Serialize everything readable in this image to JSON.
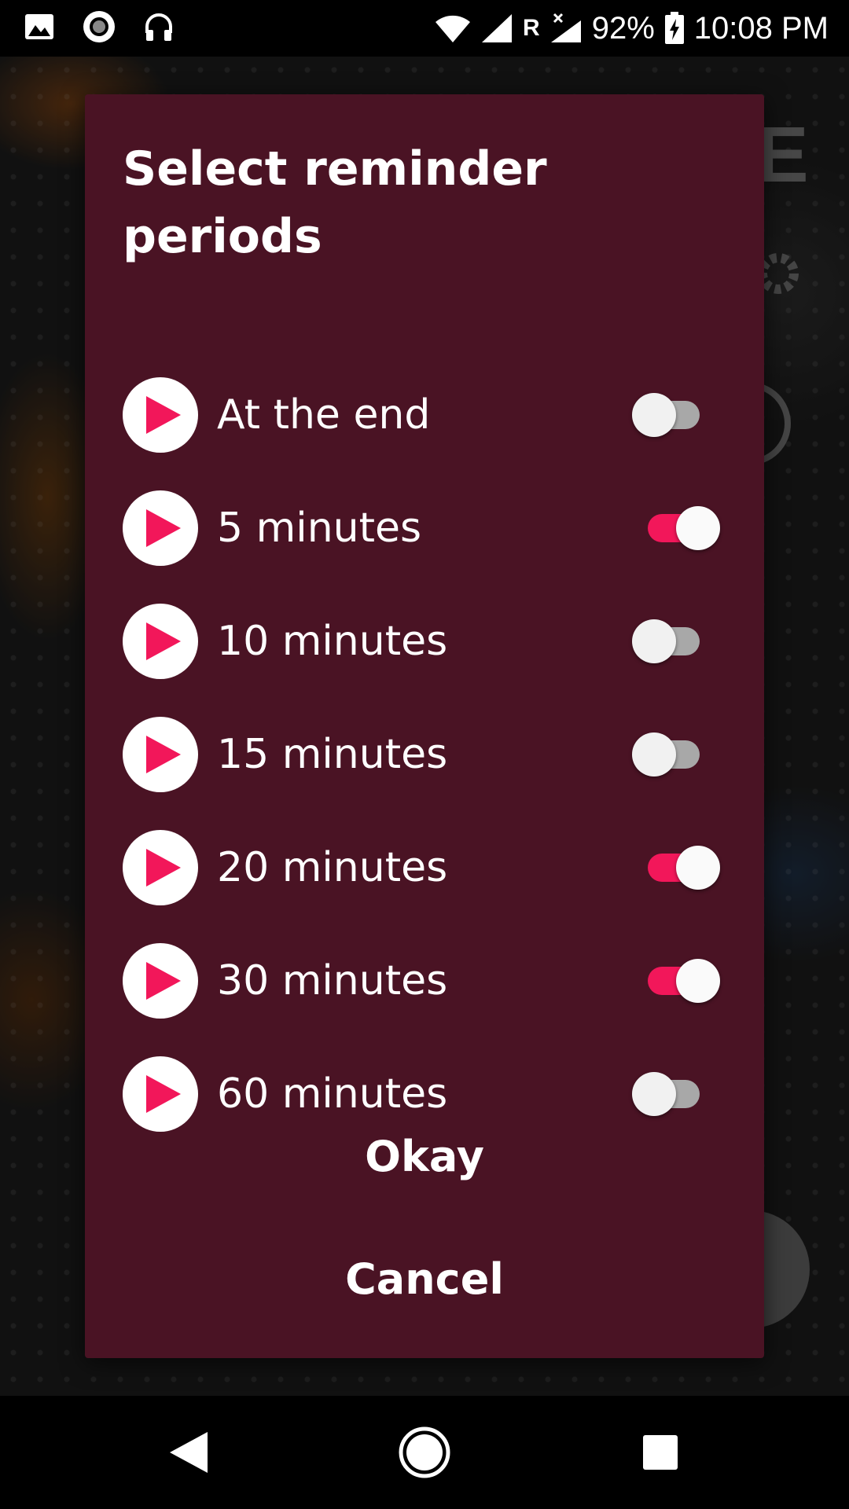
{
  "status_bar": {
    "battery": "92%",
    "time": "10:08 PM",
    "roaming": "R",
    "icons": [
      "image-icon",
      "radio-icon",
      "headphones-icon",
      "wifi-icon",
      "signal-icon",
      "signal-x-icon",
      "battery-charging-icon"
    ]
  },
  "background": {
    "partial_letter": "E"
  },
  "dialog": {
    "title": "Select reminder periods",
    "options": [
      {
        "label": "At the end",
        "enabled": false
      },
      {
        "label": "5 minutes",
        "enabled": true
      },
      {
        "label": "10 minutes",
        "enabled": false
      },
      {
        "label": "15 minutes",
        "enabled": false
      },
      {
        "label": "20 minutes",
        "enabled": true
      },
      {
        "label": "30 minutes",
        "enabled": true
      },
      {
        "label": "60 minutes",
        "enabled": false
      }
    ],
    "okay_label": "Okay",
    "cancel_label": "Cancel"
  },
  "colors": {
    "dialog_background": "#4a1324",
    "accent": "#f2175a",
    "toggle_off_track": "#a8a8a8"
  },
  "nav_bar": {
    "icons": [
      "back-icon",
      "home-icon",
      "recents-icon"
    ]
  }
}
